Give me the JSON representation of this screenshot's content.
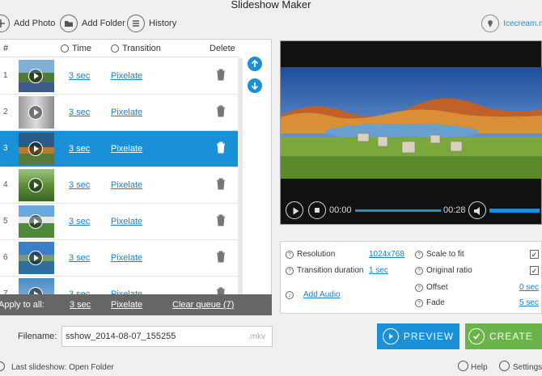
{
  "window": {
    "title": "Slideshow Maker"
  },
  "toolbar": {
    "add_photo": "Add Photo",
    "add_folder": "Add Folder",
    "history": "History",
    "brand": "Icecream.mo"
  },
  "list": {
    "headers": {
      "num": "#",
      "time": "Time",
      "transition": "Transition",
      "delete": "Delete"
    },
    "rows": [
      {
        "num": "1",
        "time": "3 sec",
        "transition": "Pixelate"
      },
      {
        "num": "2",
        "time": "3 sec",
        "transition": "Pixelate"
      },
      {
        "num": "3",
        "time": "3 sec",
        "transition": "Pixelate"
      },
      {
        "num": "4",
        "time": "3 sec",
        "transition": "Pixelate"
      },
      {
        "num": "5",
        "time": "3 sec",
        "transition": "Pixelate"
      },
      {
        "num": "6",
        "time": "3 sec",
        "transition": "Pixelate"
      },
      {
        "num": "7",
        "time": "3 sec",
        "transition": "Pixelate"
      }
    ],
    "selected_row": 3
  },
  "apply_bar": {
    "label": "Apply to all:",
    "time": "3 sec",
    "transition": "Pixelate",
    "clear": "Clear queue (7)"
  },
  "player": {
    "current": "00:00",
    "total": "00:28",
    "progress": 0.0
  },
  "settings": {
    "resolution_label": "Resolution",
    "resolution_value": "1024x768",
    "transition_duration_label": "Transition duration",
    "transition_duration_value": "1 sec",
    "add_audio": "Add Audio",
    "scale_to_fit_label": "Scale to fit",
    "scale_to_fit_checked": true,
    "original_ratio_label": "Original ratio",
    "original_ratio_checked": true,
    "offset_label": "Offset",
    "offset_value": "0 sec",
    "fade_label": "Fade",
    "fade_value": "5 sec"
  },
  "filename": {
    "label": "Filename:",
    "value": "sshow_2014-08-07_155255",
    "ext": ".mkv"
  },
  "actions": {
    "preview": "PREVIEW",
    "create": "CREATE"
  },
  "footer": {
    "last_slideshow": "Last slideshow: Open Folder",
    "help": "Help",
    "settings": "Settings"
  }
}
